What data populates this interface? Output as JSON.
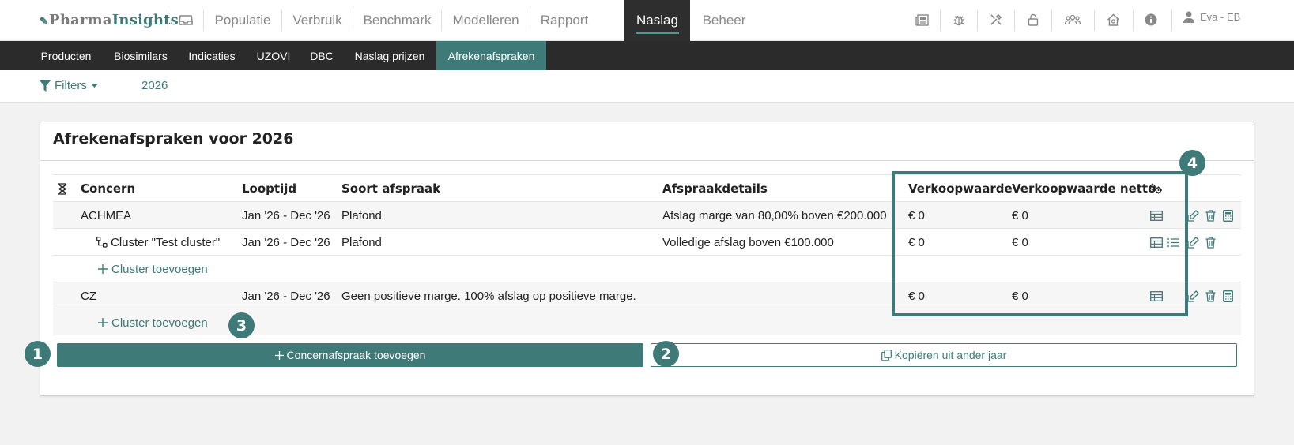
{
  "brand": {
    "logo_prefix": "Pharma",
    "logo_suffix": "Insights",
    "accent": "#3d7a78"
  },
  "topnav": {
    "items": [
      "Populatie",
      "Verbruik",
      "Benchmark",
      "Modelleren",
      "Rapport",
      "Naslag",
      "Beheer"
    ],
    "active": "Naslag",
    "user": "Eva - EB"
  },
  "subnav": {
    "items": [
      "Producten",
      "Biosimilars",
      "Indicaties",
      "UZOVI",
      "DBC",
      "Naslag prijzen",
      "Afrekenafspraken"
    ],
    "active": "Afrekenafspraken"
  },
  "filters": {
    "label": "Filters",
    "year": "2026"
  },
  "panel": {
    "title": "Afrekenafspraken voor 2026",
    "columns": [
      "Concern",
      "Looptijd",
      "Soort afspraak",
      "Afspraakdetails",
      "Verkoopwaarde",
      "Verkoopwaarde netto"
    ],
    "rows": [
      {
        "concern": "ACHMEA",
        "looptijd": "Jan '26 - Dec '26",
        "soort": "Plafond",
        "details": "Afslag marge van 80,00% boven €200.000",
        "verkoop": "€ 0",
        "netto": "€ 0"
      },
      {
        "concern": "Cluster \"Test cluster\"",
        "looptijd": "Jan '26 - Dec '26",
        "soort": "Plafond",
        "details": "Volledige afslag boven €100.000",
        "verkoop": "€ 0",
        "netto": "€ 0"
      },
      {
        "add": "Cluster toevoegen"
      },
      {
        "concern": "CZ",
        "looptijd": "Jan '26 - Dec '26",
        "soort": "Geen positieve marge. 100% afslag op positieve marge.",
        "details": "",
        "verkoop": "€ 0",
        "netto": "€ 0"
      },
      {
        "add": "Cluster toevoegen"
      }
    ],
    "add_concern_label": "Concernafspraak toevoegen",
    "copy_label": "Kopiëren uit ander jaar"
  },
  "callouts": [
    "1",
    "2",
    "3",
    "4"
  ]
}
